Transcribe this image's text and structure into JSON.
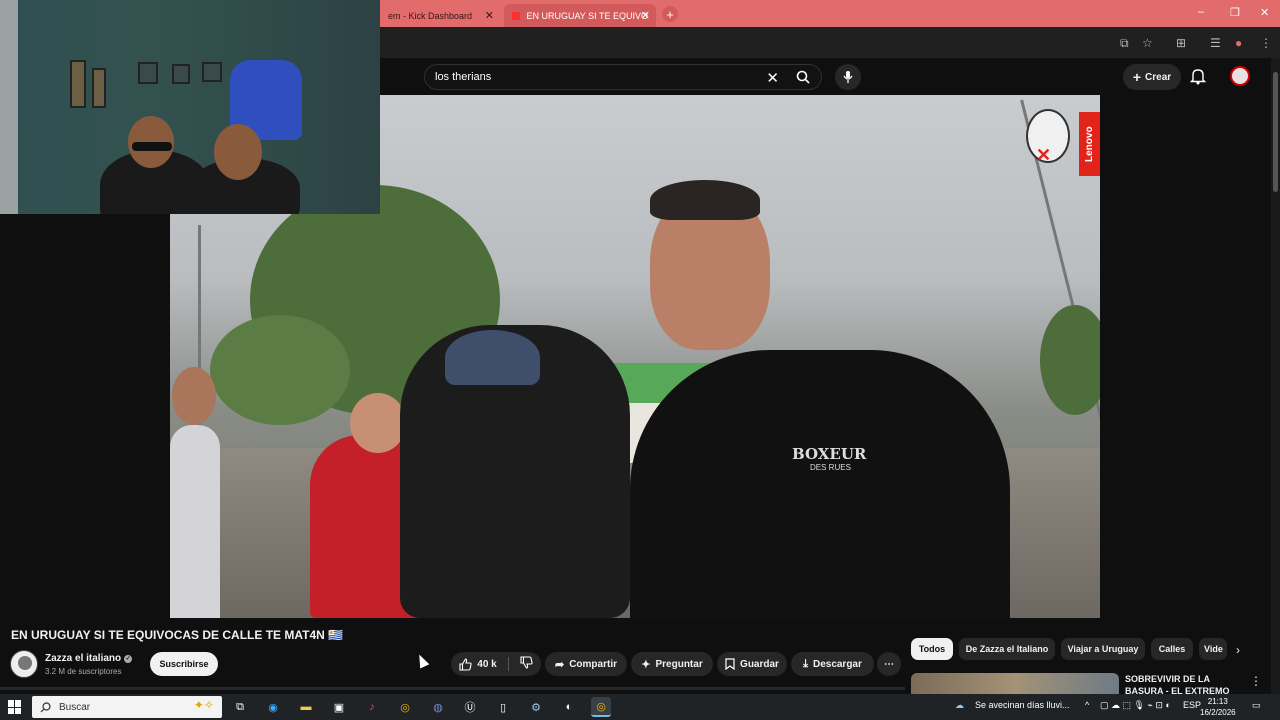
{
  "browser": {
    "tabs": [
      {
        "label": "em - Kick Dashboard",
        "active": false
      },
      {
        "label": "EN URUGUAY SI TE EQUIVO",
        "active": true
      }
    ],
    "new_tab_icon": "plus-icon",
    "window_controls": [
      "–",
      "❐",
      "✕"
    ]
  },
  "youtube": {
    "search_value": "los therians",
    "create_label": "Crear",
    "video": {
      "title": "EN URUGUAY SI TE EQUIVOCAS DE CALLE TE MAT4N 🇺🇾",
      "shirt_text": "BOXEUR",
      "shirt_subtext": "DES RUES",
      "sponsor": "Lenovo"
    },
    "channel": {
      "name": "Zazza el italiano",
      "subscribers": "3.2 M de suscriptores",
      "subscribe_label": "Suscribirse"
    },
    "actions": {
      "likes": "40 k",
      "share": "Compartir",
      "ask": "Preguntar",
      "save": "Guardar",
      "download": "Descargar"
    },
    "chips": [
      "Todos",
      "De Zazza el Italiano",
      "Viajar a Uruguay",
      "Calles",
      "Vide"
    ],
    "recommendation": {
      "title": "SOBREVIVIR DE LA BASURA - EL EXTREMO CONTRAST"
    }
  },
  "taskbar": {
    "search_placeholder": "Buscar",
    "weather": "Se avecinan días lluvi...",
    "language": "ESP",
    "time": "21:13",
    "date": "16/2/2026"
  },
  "colors": {
    "tab_bar": "#e26c6c",
    "yt_background": "#0f0f0f",
    "pill": "#272727",
    "accent_red": "#ff0000"
  }
}
